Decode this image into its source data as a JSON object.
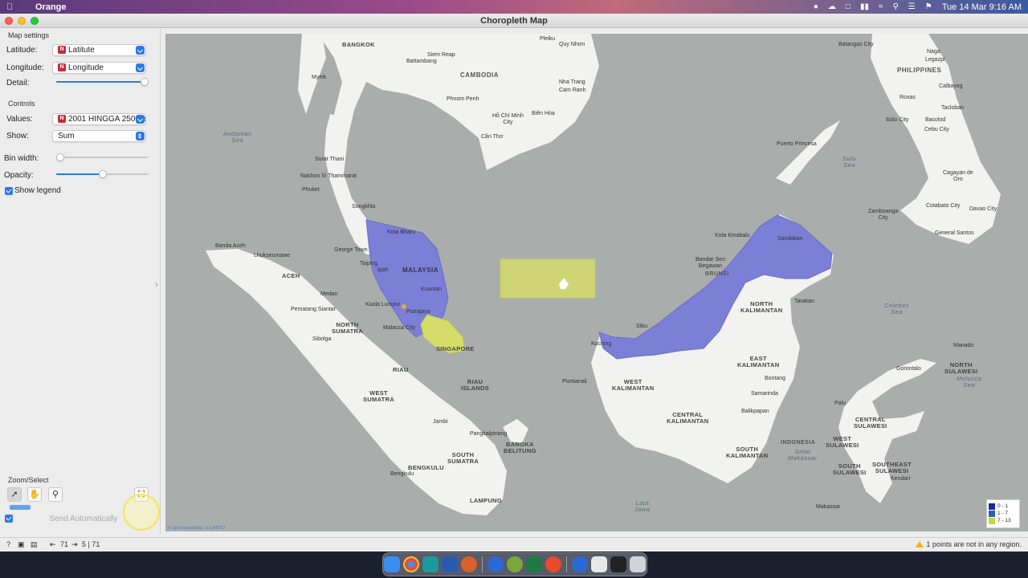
{
  "menubar": {
    "app_name": "Orange",
    "datetime": "Tue 14 Mar  9:16 AM"
  },
  "window": {
    "title": "Choropleth Map"
  },
  "sidebar": {
    "map_settings_title": "Map settings",
    "latitude_label": "Latitude:",
    "latitude_value": "Latitute",
    "latitude_badge": "N",
    "longitude_label": "Longitude:",
    "longitude_value": "Longitude",
    "longitude_badge": "N",
    "detail_label": "Detail:",
    "detail_level": 1.0,
    "controls_title": "Controls",
    "values_label": "Values:",
    "values_value": "2001 HINGGA 2500cc",
    "values_badge": "N",
    "show_label": "Show:",
    "show_value": "Sum",
    "bin_width_label": "Bin width:",
    "bin_width_level": 0.0,
    "opacity_label": "Opacity:",
    "opacity_level": 0.5,
    "show_legend_label": "Show legend",
    "show_legend_checked": true,
    "zoom_select_title": "Zoom/Select",
    "send_automatically_label": "Send Automatically",
    "send_automatically_checked": true
  },
  "map": {
    "labels": {
      "bangkok": "BANGKOK",
      "cambodia": "CAMBODIA",
      "phnom_penh": "Phnom Penh",
      "siem_reap": "Siem Reap",
      "battambang": "Battambang",
      "pleiku": "Pleiku",
      "quy_nhon": "Quy Nhơn",
      "nha_trang": "Nha Trang",
      "cam_ranh": "Cam Ranh",
      "ho_chi_minh": "Hồ Chí Minh\nCity",
      "bien_hoa": "Biên Hòa",
      "can_tho": "Cần Thơ",
      "myeik": "Myeik",
      "andaman_sea": "Andaman\nSea",
      "surat_thani": "Surat Thani",
      "nakhon": "Nakhon Si Thammarat",
      "phuket": "Phuket",
      "songkhla": "Songkhla",
      "kota_bharu": "Kota Bharu",
      "george_town": "George Town",
      "taiping": "Taiping",
      "ipoh": "Ipoh",
      "malaysia": "MALAYSIA",
      "kuantan": "Kuantan",
      "kuala_lumpur": "Kuala Lumpur",
      "putrajaya": "Putrajaya",
      "malacca": "Malacca City",
      "singapore": "SINGAPORE",
      "banda_aceh": "Banda Aceh",
      "lhokseumawe": "Lhokseumawe",
      "aceh": "ACEH",
      "medan": "Medan",
      "pematang": "Pematang Siantar",
      "north_sumatra": "NORTH\nSUMATRA",
      "sibolga": "Sibolga",
      "riau": "RIAU",
      "riau_islands": "RIAU\nISLANDS",
      "west_sumatra": "WEST\nSUMATRA",
      "jambi": "Jambi",
      "pangkalpinang": "Pangkalpinang",
      "bangka": "BANGKA\nBELITUNG",
      "south_sumatra": "SOUTH\nSUMATRA",
      "bengkulu_r": "BENGKULU",
      "bengkulu": "Bengkulu",
      "lampung": "LAMPUNG",
      "batangas": "Batangas City",
      "naga": "Naga",
      "legazpi": "Legazpi",
      "philippines": "PHILIPPINES",
      "calbayog": "Calbayog",
      "roxas": "Roxas",
      "tacloban": "Tacloban",
      "iloilo": "Iloilo City",
      "bacolod": "Bacolod",
      "cebu": "Cebu City",
      "puerto": "Puerto Princesa",
      "sulu_sea": "Sulu\nSea",
      "cagayan": "Cagayan de\nOro",
      "zamboanga": "Zamboanga\nCity",
      "cotabato": "Cotabato City",
      "davao": "Davao City",
      "general_santos": "General Santos",
      "kota_kinabalu": "Kota Kinabalu",
      "sandakan": "Sandakan",
      "bandar": "Bandar Seri\nBegawan",
      "brunei": "BRUNEI",
      "tarakan": "Tarakan",
      "north_kalimantan": "NORTH\nKALIMANTAN",
      "celebes_sea": "Celebes\nSea",
      "miri": "Sibu",
      "kuching": "Kuching",
      "pontianak": "Pontianak",
      "west_kalimantan": "WEST\nKALIMANTAN",
      "east_kalimantan": "EAST\nKALIMANTAN",
      "bontang": "Bontang",
      "samarinda": "Samarinda",
      "balikpapan": "Balikpapan",
      "central_kalimantan": "CENTRAL\nKALIMANTAN",
      "south_kalimantan": "SOUTH\nKALIMANTAN",
      "indonesia": "INDONESIA",
      "selat_makassar": "Selat\nMakassar",
      "manado": "Manado",
      "gorontalo": "Gorontalo",
      "north_sulawesi": "NORTH\nSULAWESI",
      "molucca_sea": "Molucca\nSea",
      "palu": "Palu",
      "central_sulawesi": "CENTRAL\nSULAWESI",
      "west_sulawesi": "WEST\nSULAWESI",
      "south_sulawesi": "SOUTH\nSULAWESI",
      "southeast_sulawesi": "SOUTHEAST\nSULAWESI",
      "kendari": "Kendari",
      "makassar": "Makassar",
      "laut_jawa": "Laut\nJawa"
    },
    "legend": [
      {
        "label": "0 - 1",
        "color": "#1a2a9a"
      },
      {
        "label": "1 - 7",
        "color": "#2a60c0"
      },
      {
        "label": "7 - 13",
        "color": "#c8d43a"
      }
    ],
    "attribution": "© OpenStreetMap, © CARTO",
    "colors": {
      "water": "#a9adac",
      "land": "#f2f2f0",
      "region_blue": "#7b7fd6",
      "region_yellow": "#d6dc6a"
    }
  },
  "statusbar": {
    "input_count": "71",
    "output_count": "5 | 71",
    "warning": "1 points are not in any region."
  }
}
